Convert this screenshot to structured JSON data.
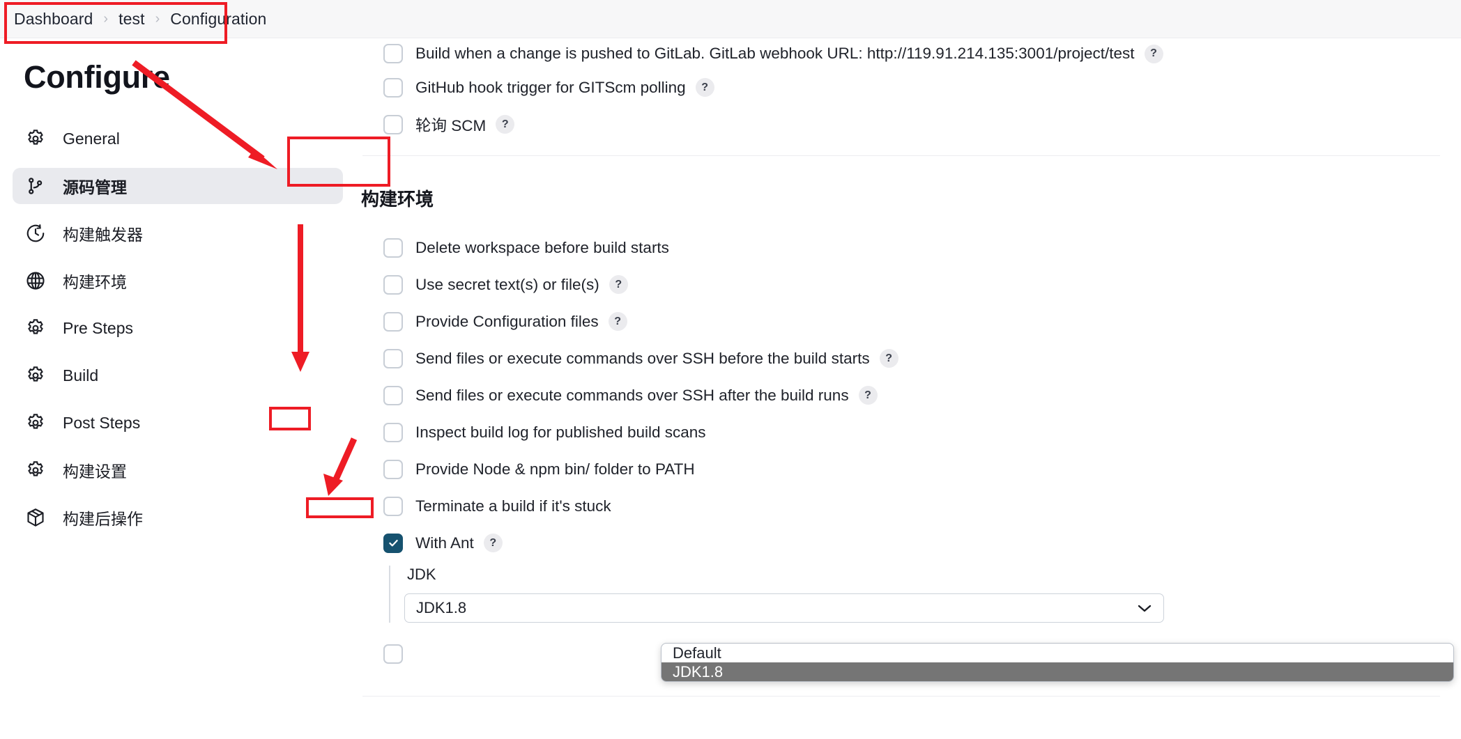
{
  "breadcrumb": {
    "items": [
      "Dashboard",
      "test",
      "Configuration"
    ],
    "separator": "›"
  },
  "sidebar": {
    "title": "Configure",
    "items": [
      {
        "label": "General",
        "icon": "gear-icon",
        "active": false
      },
      {
        "label": "源码管理",
        "icon": "branch-icon",
        "active": true
      },
      {
        "label": "构建触发器",
        "icon": "clock-icon",
        "active": false
      },
      {
        "label": "构建环境",
        "icon": "globe-icon",
        "active": false
      },
      {
        "label": "Pre Steps",
        "icon": "gear-icon",
        "active": false
      },
      {
        "label": "Build",
        "icon": "gear-icon",
        "active": false
      },
      {
        "label": "Post Steps",
        "icon": "gear-icon",
        "active": false
      },
      {
        "label": "构建设置",
        "icon": "gear-icon",
        "active": false
      },
      {
        "label": "构建后操作",
        "icon": "package-icon",
        "active": false
      }
    ]
  },
  "triggers": {
    "rows": [
      {
        "label": "Build when a change is pushed to GitLab. GitLab webhook URL: http://119.91.214.135:3001/project/test",
        "checked": false,
        "help": true
      },
      {
        "label": "GitHub hook trigger for GITScm polling",
        "checked": false,
        "help": true
      },
      {
        "label": "轮询 SCM",
        "checked": false,
        "help": true
      }
    ]
  },
  "build_env": {
    "heading": "构建环境",
    "rows": [
      {
        "label": "Delete workspace before build starts",
        "checked": false,
        "help": false
      },
      {
        "label": "Use secret text(s) or file(s)",
        "checked": false,
        "help": true
      },
      {
        "label": "Provide Configuration files",
        "checked": false,
        "help": true
      },
      {
        "label": "Send files or execute commands over SSH before the build starts",
        "checked": false,
        "help": true
      },
      {
        "label": "Send files or execute commands over SSH after the build runs",
        "checked": false,
        "help": true
      },
      {
        "label": "Inspect build log for published build scans",
        "checked": false,
        "help": false
      },
      {
        "label": "Provide Node & npm bin/ folder to PATH",
        "checked": false,
        "help": false
      },
      {
        "label": "Terminate a build if it's stuck",
        "checked": false,
        "help": false
      },
      {
        "label": "With Ant",
        "checked": true,
        "help": true
      }
    ],
    "ant": {
      "jdk_label": "JDK",
      "jdk_value": "JDK1.8",
      "jdk_options": [
        "Default",
        "JDK1.8"
      ],
      "jdk_selected": "JDK1.8",
      "chevron": "chevron-down-icon"
    },
    "trailing_row": {
      "label": "",
      "checked": false
    }
  },
  "annotations": {
    "color": "#ee1c25",
    "boxes": [
      "breadcrumb-highlight",
      "build-env-heading-highlight",
      "with-ant-checkbox-highlight",
      "jdk18-option-highlight"
    ],
    "arrows": [
      "arrow-to-build-env-heading",
      "arrow-down-checkbox-column",
      "arrow-to-jdk18-option"
    ]
  }
}
